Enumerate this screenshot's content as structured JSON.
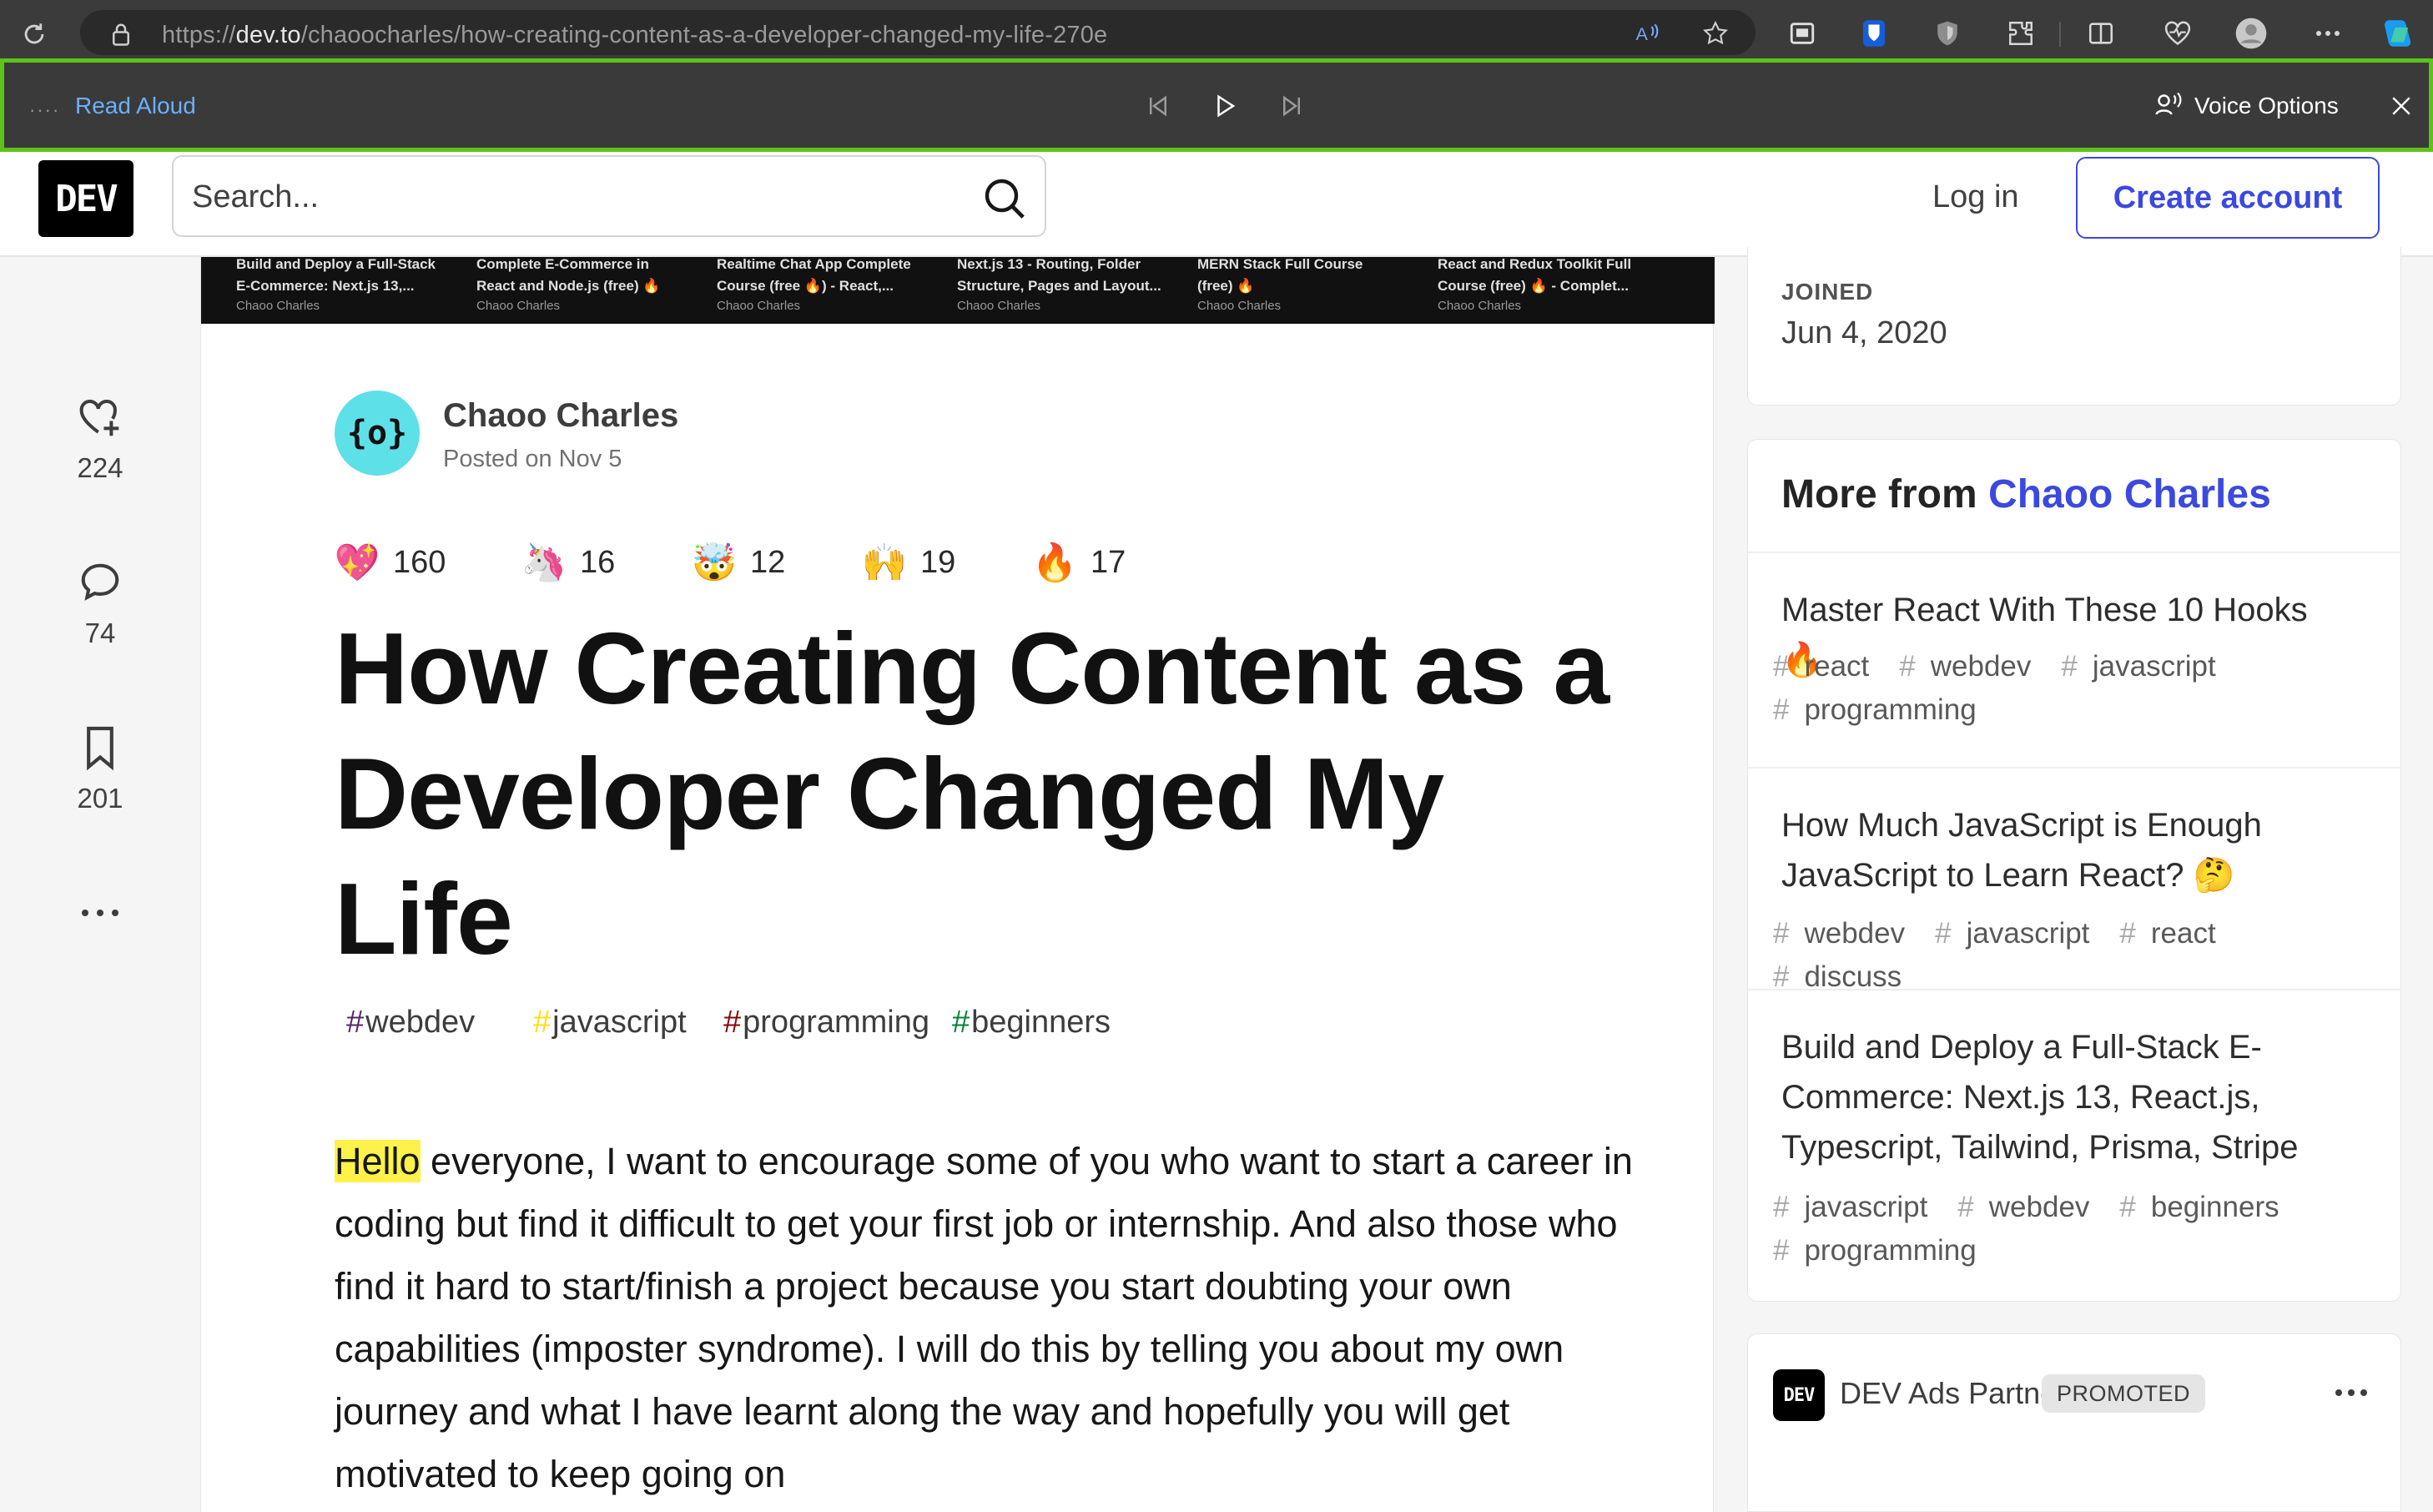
{
  "browser": {
    "url_prefix": "https://",
    "url_host": "dev.to",
    "url_path": "/chaoocharles/how-creating-content-as-a-developer-changed-my-life-270e"
  },
  "read_aloud": {
    "label": "Read Aloud",
    "voice_options": "Voice Options",
    "handle": "····"
  },
  "header": {
    "logo": "DEV",
    "search_placeholder": "Search...",
    "login": "Log in",
    "create_account": "Create account"
  },
  "rail": {
    "likes": "224",
    "comments": "74",
    "bookmarks": "201"
  },
  "cover": {
    "cards": [
      {
        "title": "Build and Deploy a Full-Stack\nE-Commerce: Next.js 13,...",
        "author": "Chaoo Charles"
      },
      {
        "title": "Complete E-Commerce in\nReact and Node.js (free) 🔥...",
        "author": "Chaoo Charles"
      },
      {
        "title": "Realtime Chat App Complete\nCourse (free 🔥) - React,...",
        "author": "Chaoo Charles"
      },
      {
        "title": "Next.js 13 - Routing, Folder\nStructure, Pages and Layout...",
        "author": "Chaoo Charles"
      },
      {
        "title": "MERN Stack Full Course\n(free) 🔥",
        "author": "Chaoo Charles"
      },
      {
        "title": "React and Redux Toolkit Full\nCourse (free) 🔥 - Complet...",
        "author": "Chaoo Charles"
      }
    ]
  },
  "article": {
    "author": "Chaoo Charles",
    "avatar_text": "{o}",
    "posted": "Posted on Nov 5",
    "reactions": [
      {
        "emoji": "💖",
        "name": "heart",
        "count": "160"
      },
      {
        "emoji": "🦄",
        "name": "unicorn",
        "count": "16"
      },
      {
        "emoji": "🤯",
        "name": "exploding-head",
        "count": "12"
      },
      {
        "emoji": "🙌",
        "name": "raised-hands",
        "count": "19"
      },
      {
        "emoji": "🔥",
        "name": "fire",
        "count": "17"
      }
    ],
    "title": "How Creating Content as a Developer Changed My Life",
    "tags": [
      {
        "name": "webdev",
        "hash_color": "#562765"
      },
      {
        "name": "javascript",
        "hash_color": "#f7df1e"
      },
      {
        "name": "programming",
        "hash_color": "#890606"
      },
      {
        "name": "beginners",
        "hash_color": "#008335"
      }
    ],
    "body_highlight": "Hello",
    "body_rest": " everyone, I want to encourage some of you who want to start a career in coding but find it difficult to get your first job or internship. And also those who find it hard to start/finish a project because you start doubting your own capabilities (imposter syndrome). I will do this by telling you about my own journey and what I have learnt along the way and hopefully you will get motivated to keep going on"
  },
  "sidebar": {
    "joined_label": "JOINED",
    "joined_date": "Jun 4, 2020",
    "more_from_prefix": "More from",
    "more_from_author": "Chaoo Charles",
    "more_items": [
      {
        "title": "Master React With These 10 Hooks 🔥",
        "tags": [
          "react",
          "webdev",
          "javascript",
          "programming"
        ]
      },
      {
        "title": "How Much JavaScript is Enough JavaScript to Learn React? 🤔",
        "tags": [
          "webdev",
          "javascript",
          "react",
          "discuss"
        ]
      },
      {
        "title": "Build and Deploy a Full-Stack E-Commerce: Next.js 13, React.js, Typescript, Tailwind, Prisma, Stripe",
        "tags": [
          "javascript",
          "webdev",
          "beginners",
          "programming"
        ]
      }
    ],
    "ad": {
      "logo": "DEV",
      "name": "DEV Ads Partner",
      "badge": "PROMOTED"
    }
  },
  "colors": {
    "accent": "#3b49df",
    "read_aloud_border": "#5ec21a",
    "highlight": "#fef24a"
  }
}
